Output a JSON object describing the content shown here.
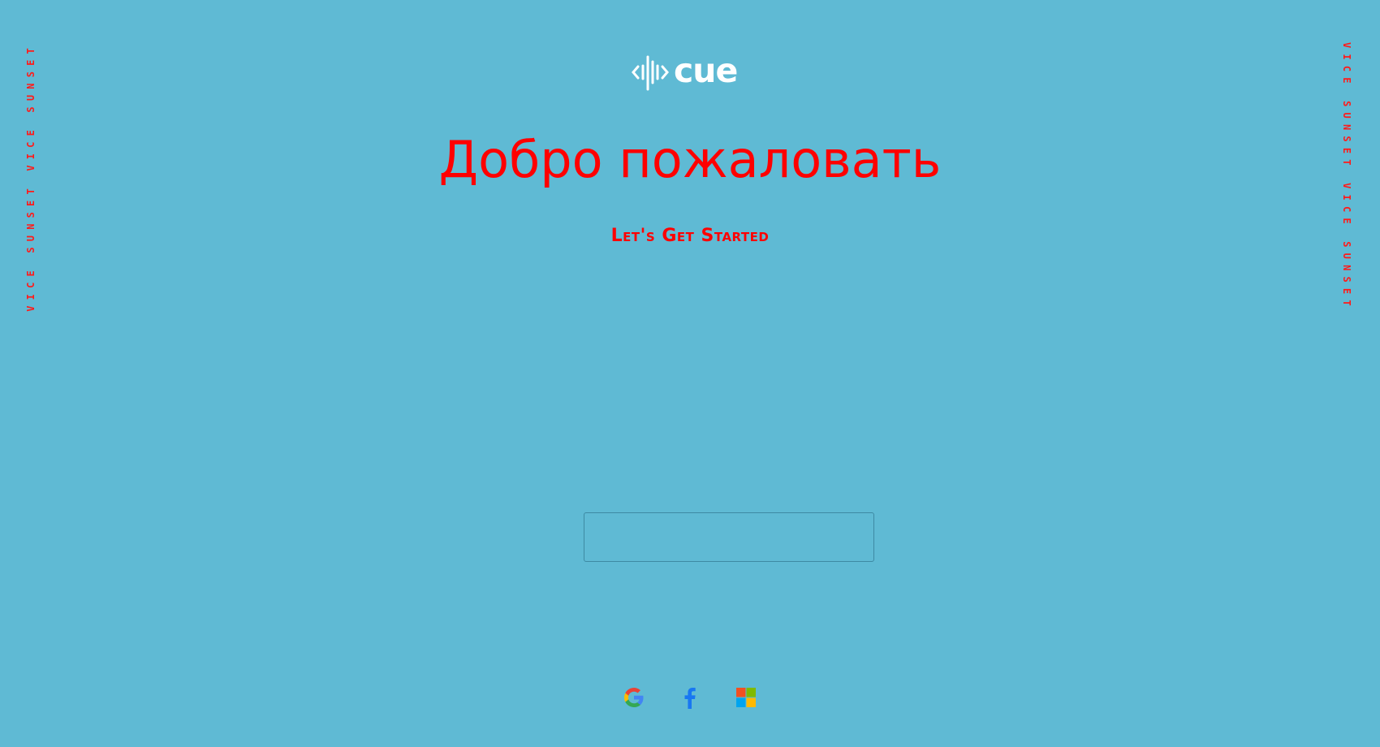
{
  "side_text": {
    "left": "vice sunset vice sunset",
    "right": "vice sunset vice sunset"
  },
  "logo": {
    "word": "cue",
    "color": "#ffffff"
  },
  "welcome": {
    "title": "Добро пожаловать",
    "subtitle": "Let's Get Started"
  },
  "form": {
    "input_value": "",
    "input_placeholder": ""
  },
  "social_login": [
    {
      "icon": "google-icon",
      "provider": "Google"
    },
    {
      "icon": "facebook-icon",
      "provider": "Facebook"
    },
    {
      "icon": "microsoft-icon",
      "provider": "Microsoft"
    }
  ],
  "colors": {
    "background": "#5fbad4",
    "accent_text": "#ff0000",
    "side_text": "#ff1a1a",
    "logo": "#ffffff"
  }
}
